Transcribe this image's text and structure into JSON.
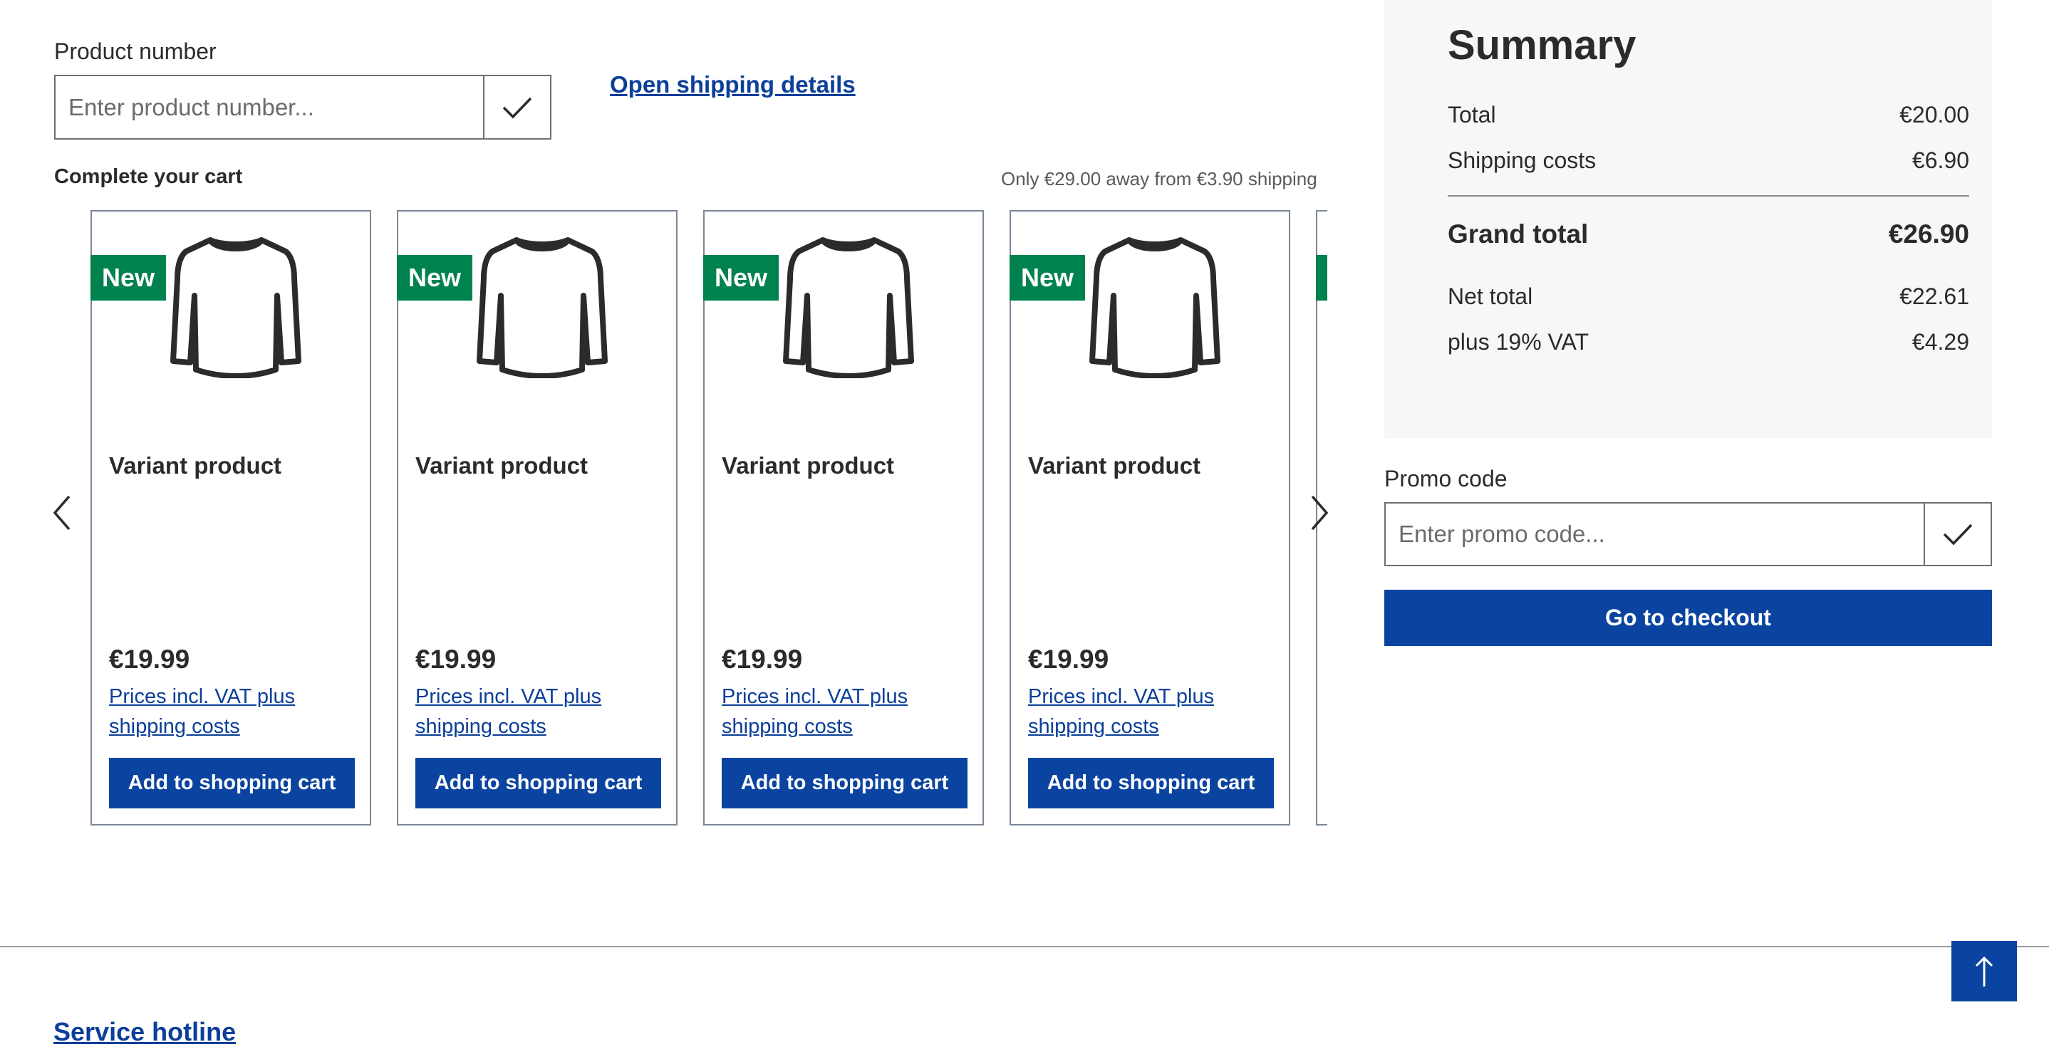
{
  "product_number": {
    "label": "Product number",
    "placeholder": "Enter product number...",
    "value": ""
  },
  "shipping_details_link": "Open shipping details",
  "cart_suggestions": {
    "title": "Complete your cart",
    "shipping_note": "Only €29.00 away from €3.90 shipping",
    "products": [
      {
        "badge": "New",
        "name": "Variant product",
        "price": "€19.99",
        "vat_note": "Prices incl. VAT plus shipping costs",
        "button": "Add to shopping cart"
      },
      {
        "badge": "New",
        "name": "Variant product",
        "price": "€19.99",
        "vat_note": "Prices incl. VAT plus shipping costs",
        "button": "Add to shopping cart"
      },
      {
        "badge": "New",
        "name": "Variant product",
        "price": "€19.99",
        "vat_note": "Prices incl. VAT plus shipping costs",
        "button": "Add to shopping cart"
      },
      {
        "badge": "New",
        "name": "Variant product",
        "price": "€19.99",
        "vat_note": "Prices incl. VAT plus shipping costs",
        "button": "Add to shopping cart"
      }
    ]
  },
  "summary": {
    "title": "Summary",
    "total_label": "Total",
    "total_value": "€20.00",
    "shipping_label": "Shipping costs",
    "shipping_value": "€6.90",
    "grand_total_label": "Grand total",
    "grand_total_value": "€26.90",
    "net_total_label": "Net total",
    "net_total_value": "€22.61",
    "vat_label": "plus 19% VAT",
    "vat_value": "€4.29"
  },
  "promo": {
    "label": "Promo code",
    "placeholder": "Enter promo code...",
    "value": ""
  },
  "checkout_button": "Go to checkout",
  "footer": {
    "service_heading": "Service hotline"
  },
  "colors": {
    "primary": "#0b44a0",
    "badge": "#00824f",
    "summary_bg": "#f7f7f7"
  },
  "icons": {
    "submit": "checkmark-icon",
    "prev": "chevron-left-icon",
    "next": "chevron-right-icon",
    "top": "arrow-up-icon",
    "product": "shirt-icon"
  }
}
